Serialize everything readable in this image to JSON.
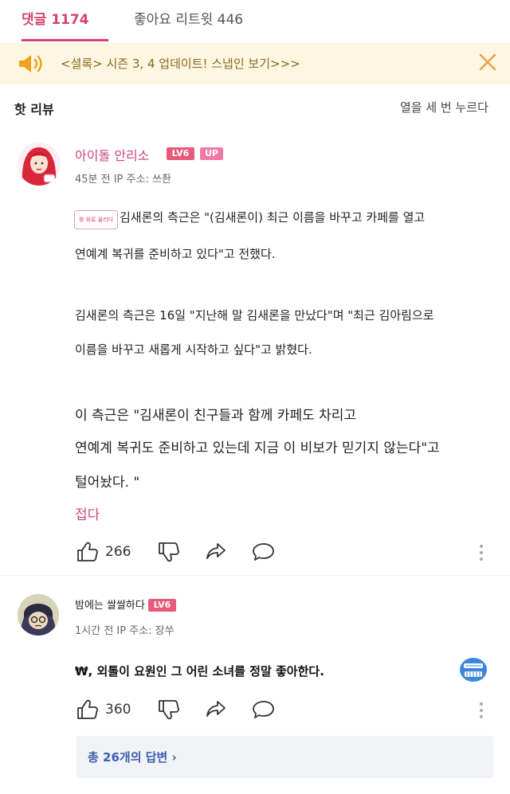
{
  "tabs": {
    "comments": "댓글 1174",
    "likes": "좋아요 리트윗 446"
  },
  "notice": {
    "text": "<셜록> 시즌 3, 4 업데이트! 스냅인 보기>>>"
  },
  "section": {
    "title": "핫 리뷰",
    "action": "열을 세 번 누르다"
  },
  "comment1": {
    "username": "아이돌 안리소",
    "level_badge": "LV6",
    "up_badge": "UP",
    "meta": "45분 전 IP 주소: 쓰촨",
    "mini_badge": "왕 위로 올리다",
    "lines": [
      "김새론의 측근은 \"(김새론이) 최근 이름을 바꾸고 카페를 열고",
      "연예계 복귀를 준비하고 있다\"고 전했다.",
      "김새론의 측근은 16일 \"지난해 말 김새론을 만났다\"며 \"최근 김아림으로",
      "이름을 바꾸고 새롭게 시작하고 싶다\"고 밝혔다.",
      "이 측근은 \"김새론이 친구들과 함께 카페도 차리고",
      "연예계 복귀도 준비하고 있는데 지금 이 비보가 믿기지 않는다\"고",
      "털어놨다. \""
    ],
    "fold": "접다",
    "likes": "266"
  },
  "comment2": {
    "username": "밤에는 쌀쌀하다",
    "level_badge": "LV6",
    "meta": "1시간 전 IP 주소: 장쑤",
    "text": "₩, 외톨이 요원인 그 어린 소녀를 정말 좋아한다.",
    "likes": "360",
    "replies": "총 26개의 답변 ›"
  },
  "colors": {
    "accent": "#d6436e",
    "notice_bg": "#fdf6e3",
    "notice_text": "#8b6a1e",
    "reply_link": "#3a5fb0"
  },
  "icons": [
    "speaker-icon",
    "close-icon",
    "thumbs-up-icon",
    "thumbs-down-icon",
    "share-icon",
    "reply-icon",
    "more-icon",
    "emoji-face-icon"
  ]
}
